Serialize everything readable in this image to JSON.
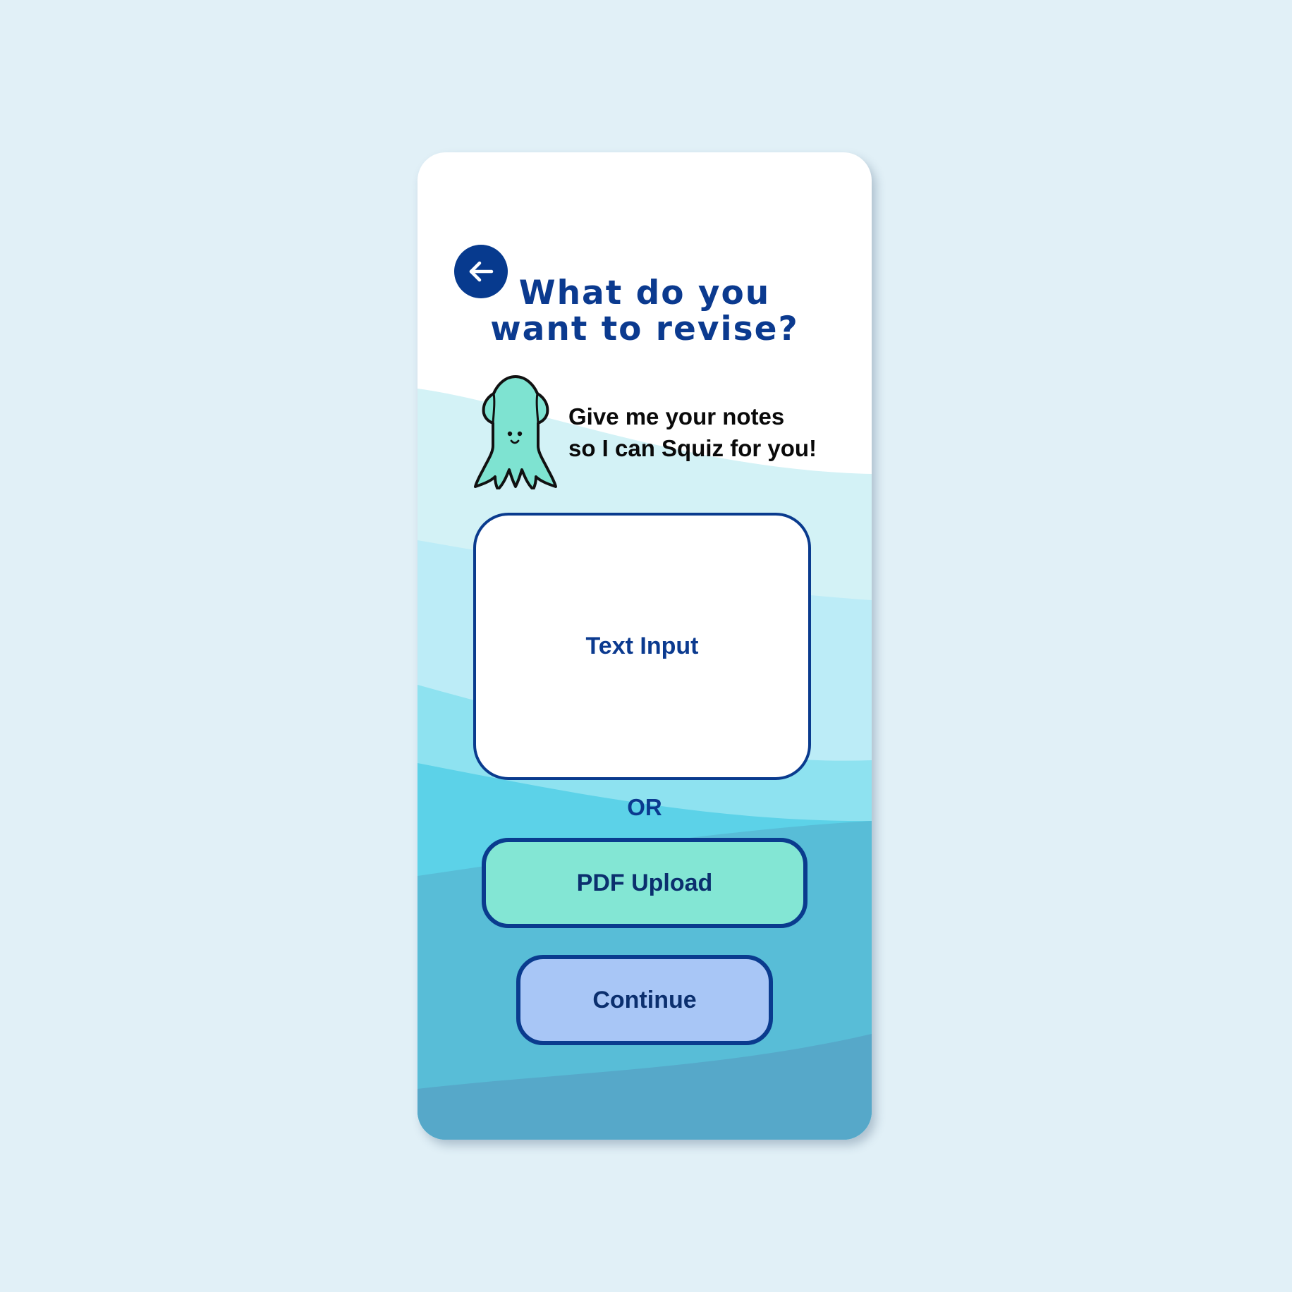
{
  "colors": {
    "page_background": "#e1f0f7",
    "card_background": "#ffffff",
    "accent_navy": "#0a3b8e",
    "mascot_green": "#7ee3d1",
    "pdf_button_fill": "#83e6d4",
    "continue_button_fill": "#a8c6f6",
    "wave_colors": [
      "#d3f2f6",
      "#bcecf7",
      "#8ee2f0",
      "#5cd2e8",
      "#58bdd7",
      "#56a8c9"
    ]
  },
  "header": {
    "back_icon": "arrow-left-icon",
    "title_line_1": "What do you",
    "title_line_2": "want to revise?"
  },
  "mascot": {
    "icon": "squid-mascot-icon",
    "speech_line_1": "Give me your notes",
    "speech_line_2": "so I can Squiz for you!"
  },
  "input": {
    "text_input_label": "Text Input"
  },
  "divider": {
    "or_label": "OR"
  },
  "actions": {
    "pdf_upload_label": "PDF Upload",
    "continue_label": "Continue"
  }
}
